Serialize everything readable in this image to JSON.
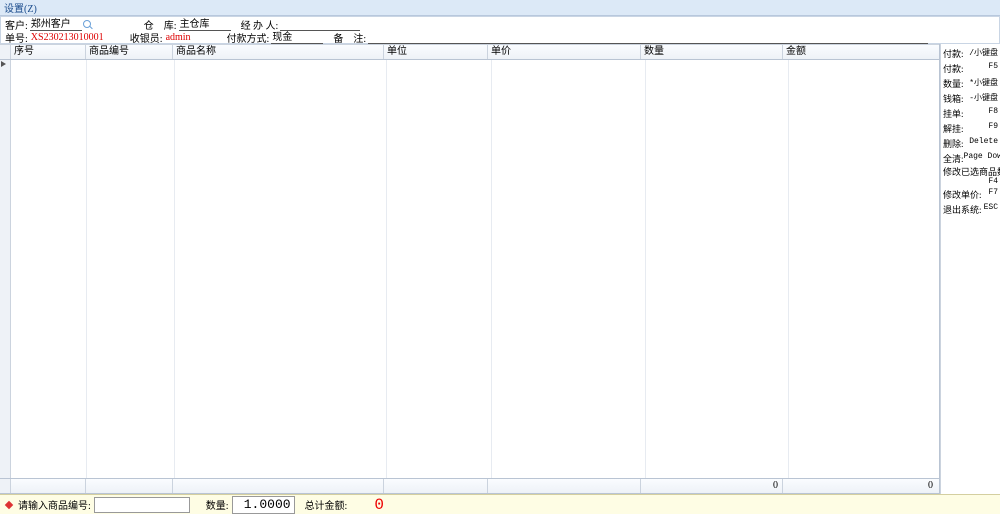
{
  "menu": {
    "settings": "设置(Z)"
  },
  "form": {
    "customer_label": "客户:",
    "customer_value": "郑州客户",
    "order_label": "单号:",
    "order_value": "XS230213010001",
    "warehouse_label": "仓　库:",
    "warehouse_value": "主仓库",
    "cashier_label": "收银员:",
    "cashier_value": "admin",
    "handler_label": "经 办 人:",
    "handler_value": "",
    "paymethod_label": "付款方式:",
    "paymethod_value": "现金",
    "remark_label": "备　注:",
    "remark_value": ""
  },
  "columns": {
    "seq": "序号",
    "code": "商品编号",
    "name": "商品名称",
    "unit": "单位",
    "price": "单价",
    "qty": "数量",
    "amount": "金额"
  },
  "footer": {
    "qty_total": "0",
    "amount_total": "0"
  },
  "shortcuts": [
    {
      "k": "付款:",
      "v": "/小键盘"
    },
    {
      "k": "付款:",
      "v": "F5"
    },
    {
      "k": "数量:",
      "v": "*小键盘"
    },
    {
      "k": "钱箱:",
      "v": "-小键盘"
    },
    {
      "k": "挂单:",
      "v": "F8"
    },
    {
      "k": "解挂:",
      "v": "F9"
    },
    {
      "k": "删除:",
      "v": "Delete"
    },
    {
      "k": "全清:",
      "v": "Page Down"
    },
    {
      "k": "修改已选商品数量:",
      "v": "F4",
      "multi": true
    },
    {
      "k": "修改单价:",
      "v": "F7"
    },
    {
      "k": "退出系统:",
      "v": "ESC"
    }
  ],
  "bottom": {
    "prompt": "请输入商品编号:",
    "qty_label": "数量:",
    "qty_value": "1.0000",
    "total_label": "总计金额:",
    "total_value": "0"
  }
}
